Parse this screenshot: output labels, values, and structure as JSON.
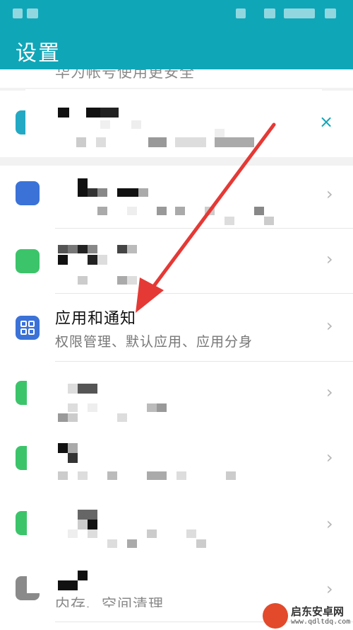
{
  "header": {
    "title": "设置"
  },
  "account_banner": {
    "cutoff_text": "华为帐号使用更安全",
    "close_icon": "close-icon",
    "close_glyph": "×"
  },
  "items": {
    "apps_notifications": {
      "title": "应用和通知",
      "subtitle": "权限管理、默认应用、应用分身",
      "icon": "grid-apps-icon"
    },
    "storage": {
      "cutoff_subtitle": "内存、空间清理"
    }
  },
  "chevron_glyph": "›",
  "colors": {
    "accent": "#0fa6b8",
    "arrow": "#e53935",
    "icon_blue": "#3a72d8",
    "icon_green": "#3cc46a",
    "icon_grey": "#8a8a8a"
  },
  "watermark": {
    "name": "启东安卓网",
    "url": "www.qdltdq.com"
  }
}
